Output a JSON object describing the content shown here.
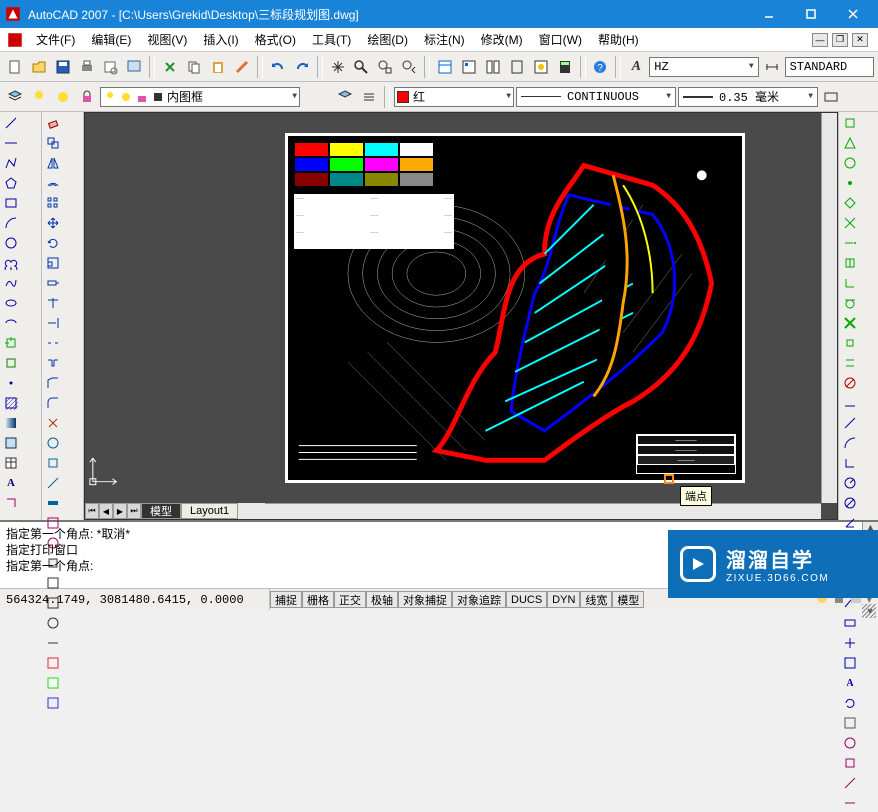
{
  "title": "AutoCAD 2007 - [C:\\Users\\Grekid\\Desktop\\三标段规划图.dwg]",
  "menu": [
    "文件(F)",
    "编辑(E)",
    "视图(V)",
    "插入(I)",
    "格式(O)",
    "工具(T)",
    "绘图(D)",
    "标注(N)",
    "修改(M)",
    "窗口(W)",
    "帮助(H)"
  ],
  "layer_selector": "内图框",
  "color_selector": "红",
  "linetype_selector": "CONTINUOUS",
  "lineweight_selector": "0.35 毫米",
  "textstyle_label": "A",
  "textstyle_value": "HZ",
  "standard_label": "STANDARD",
  "tabs": {
    "model": "模型",
    "layout1": "Layout1"
  },
  "command_lines": [
    "指定第一个角点: *取消*",
    "指定打印窗口",
    "",
    "指定第一个角点:"
  ],
  "tooltip": "端点",
  "coords": "564324.1749, 3081480.6415, 0.0000",
  "status_buttons": [
    "捕捉",
    "栅格",
    "正交",
    "极轴",
    "对象捕捉",
    "对象追踪",
    "DUCS",
    "DYN",
    "线宽",
    "模型"
  ],
  "watermark": {
    "name": "溜溜自学",
    "url": "ZIXUE.3D66.COM"
  }
}
